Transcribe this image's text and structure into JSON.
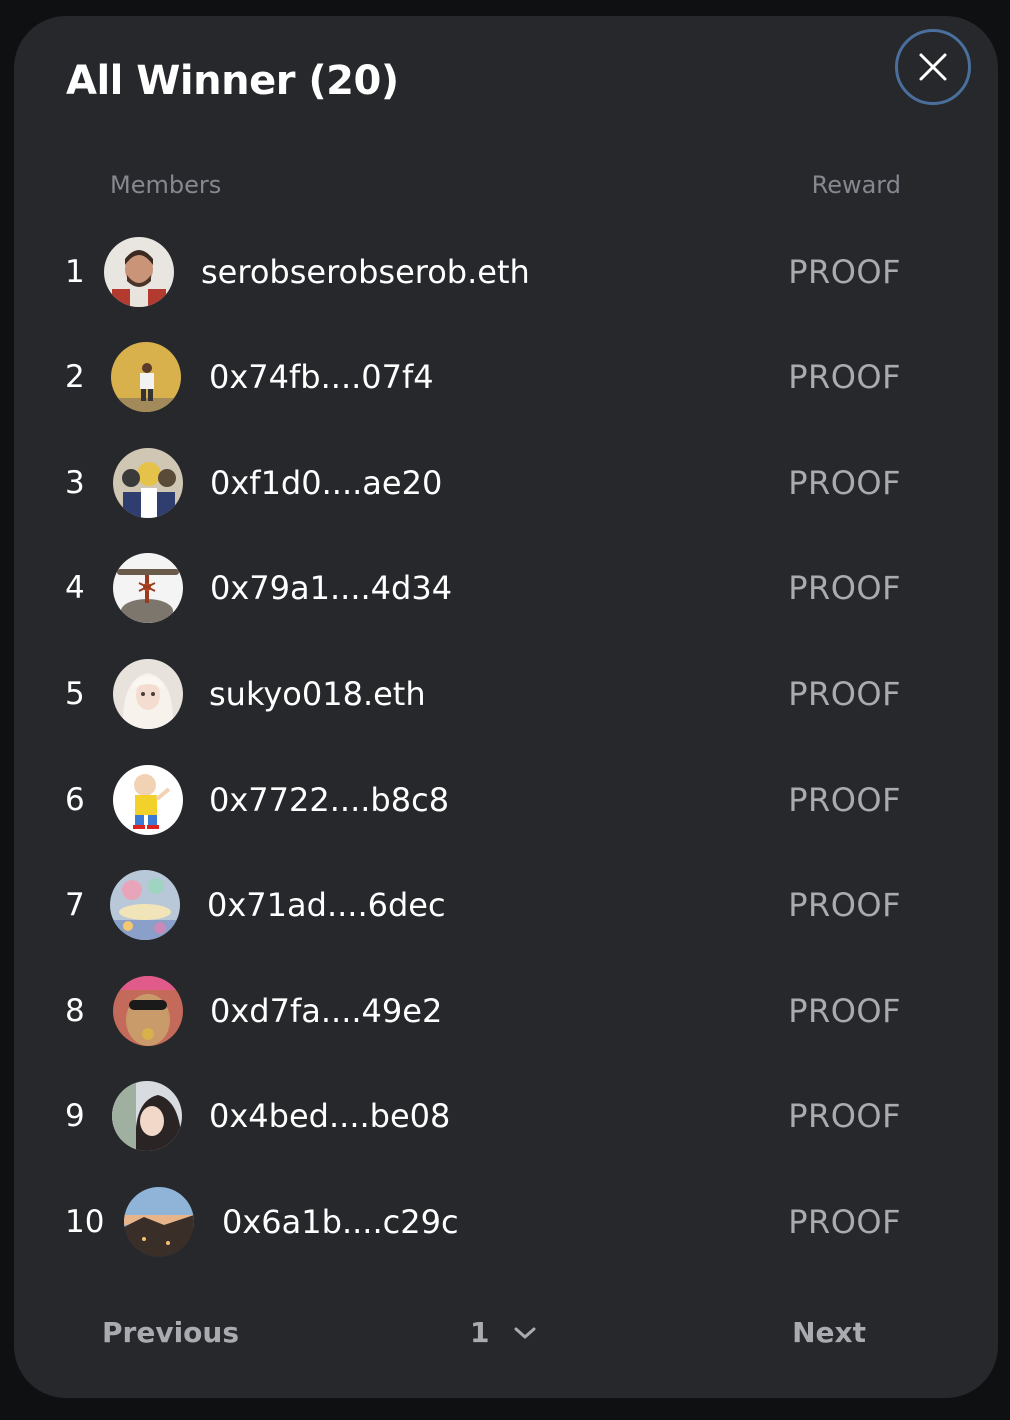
{
  "modal": {
    "title": "All Winner (20)",
    "close_icon": "close-icon"
  },
  "table": {
    "members_header": "Members",
    "reward_header": "Reward",
    "rows": [
      {
        "rank": "1",
        "name": "serobserobserob.eth",
        "reward": "PROOF",
        "avatar": "portrait-man-beard"
      },
      {
        "rank": "2",
        "name": "0x74fb....07f4",
        "reward": "PROOF",
        "avatar": "person-yellow-wall"
      },
      {
        "rank": "3",
        "name": "0xf1d0....ae20",
        "reward": "PROOF",
        "avatar": "anime-group"
      },
      {
        "rank": "4",
        "name": "0x79a1....4d34",
        "reward": "PROOF",
        "avatar": "ant-on-rock"
      },
      {
        "rank": "5",
        "name": "sukyo018.eth",
        "reward": "PROOF",
        "avatar": "anime-girl-white-hair"
      },
      {
        "rank": "6",
        "name": "0x7722....b8c8",
        "reward": "PROOF",
        "avatar": "cartoon-character"
      },
      {
        "rank": "7",
        "name": "0x71ad....6dec",
        "reward": "PROOF",
        "avatar": "pastel-illustration"
      },
      {
        "rank": "8",
        "name": "0xd7fa....49e2",
        "reward": "PROOF",
        "avatar": "sunglasses-character"
      },
      {
        "rank": "9",
        "name": "0x4bed....be08",
        "reward": "PROOF",
        "avatar": "portrait-woman"
      },
      {
        "rank": "10",
        "name": "0x6a1b....c29c",
        "reward": "PROOF",
        "avatar": "sunset-landscape"
      }
    ]
  },
  "pagination": {
    "previous_label": "Previous",
    "current_page": "1",
    "next_label": "Next",
    "dropdown_icon": "chevron-down-icon"
  }
}
